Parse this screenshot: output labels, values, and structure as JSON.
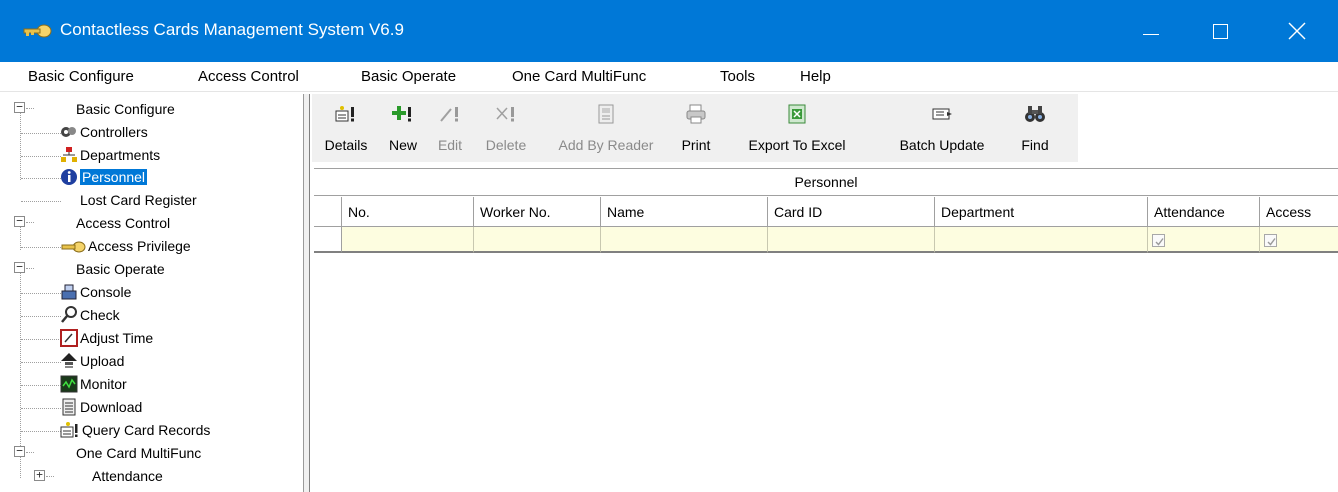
{
  "window": {
    "title": "Contactless Cards Management System  V6.9"
  },
  "menu": [
    {
      "label": "Basic Configure"
    },
    {
      "label": "Access Control"
    },
    {
      "label": "Basic Operate"
    },
    {
      "label": "One Card MultiFunc"
    },
    {
      "label": "Tools"
    },
    {
      "label": "Help"
    }
  ],
  "tree": {
    "basic_configure": "Basic Configure",
    "controllers": "Controllers",
    "departments": "Departments",
    "personnel": "Personnel",
    "lost_card_register": "Lost Card Register",
    "access_control": "Access Control",
    "access_privilege": "Access Privilege",
    "basic_operate": "Basic Operate",
    "console": "Console",
    "check": "Check",
    "adjust_time": "Adjust Time",
    "upload": "Upload",
    "monitor": "Monitor",
    "download": "Download",
    "query_card_records": "Query Card Records",
    "one_card_multifunc": "One Card MultiFunc",
    "attendance": "Attendance"
  },
  "toolbar": {
    "details": "Details",
    "new": "New",
    "edit": "Edit",
    "delete": "Delete",
    "add_by_reader": "Add By Reader",
    "print": "Print",
    "export_to_excel": "Export To Excel",
    "batch_update": "Batch Update",
    "find": "Find"
  },
  "grid": {
    "caption": "Personnel",
    "columns": [
      "No.",
      "Worker No.",
      "Name",
      "Card ID",
      "Department",
      "Attendance",
      "Access"
    ],
    "row": {
      "attendance_checked": true,
      "access_checked": true
    }
  },
  "colors": {
    "titlebar": "#0078d7",
    "selection": "#0078d7",
    "new_row": "#fdfde0"
  }
}
